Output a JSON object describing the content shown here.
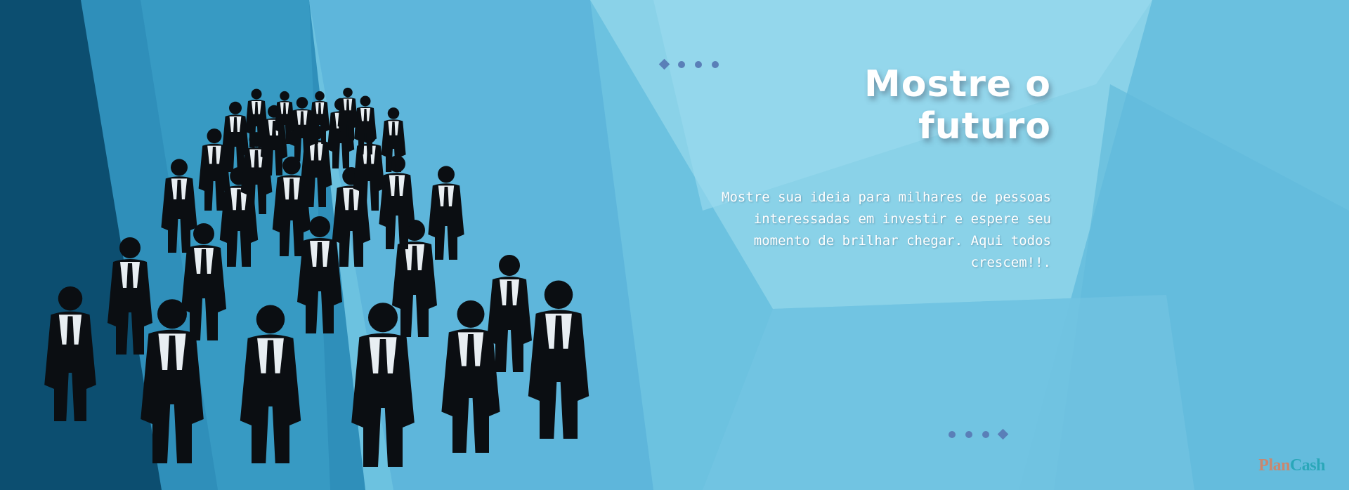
{
  "hero": {
    "title": "Mostre o futuro",
    "description": "Mostre sua ideia para milhares de pessoas interessadas em investir e espere seu momento de brilhar chegar. Aqui todos crescem!!.",
    "image_subject": "business-people-silhouettes"
  },
  "logo": {
    "part1": "Plan",
    "part2": "Cash"
  },
  "colors": {
    "background": "#6cc2e0",
    "dark_stripe": "#0c4e70",
    "accent_decor": "#5a7fb8",
    "logo_plan": "#c9876f",
    "logo_cash": "#2aa7b9",
    "text": "#ffffff"
  }
}
